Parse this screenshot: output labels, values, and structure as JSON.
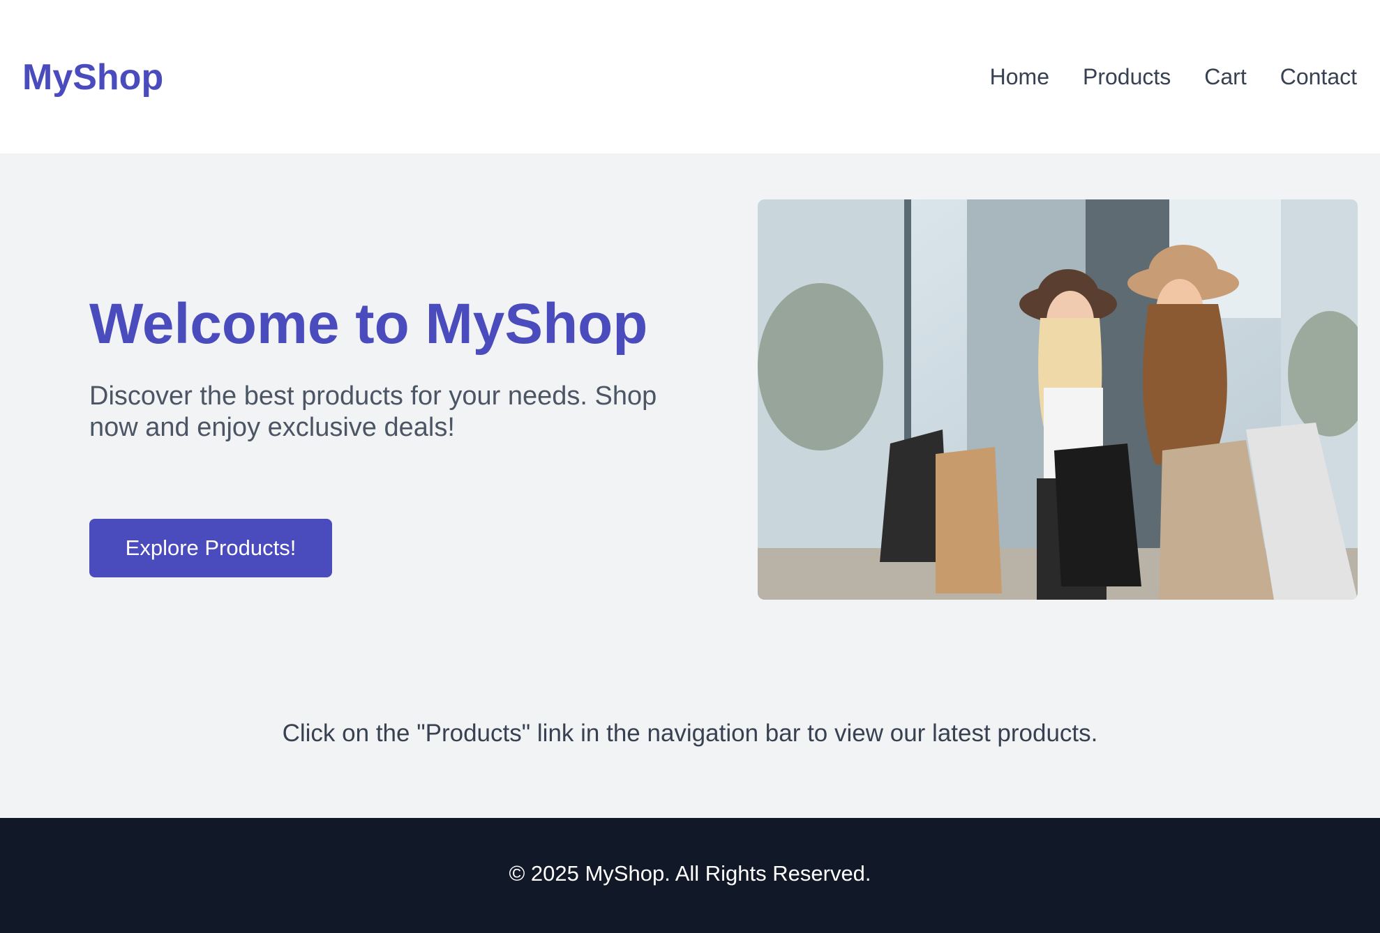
{
  "header": {
    "logo": "MyShop",
    "nav": [
      "Home",
      "Products",
      "Cart",
      "Contact"
    ]
  },
  "hero": {
    "title": "Welcome to MyShop",
    "subtitle": "Discover the best products for your needs. Shop now and enjoy exclusive deals!",
    "cta_label": "Explore Products!"
  },
  "hint": "Click on the \"Products\" link in the navigation bar to view our latest products.",
  "footer": {
    "copyright": "© 2025 MyShop. All Rights Reserved."
  },
  "colors": {
    "brand": "#4a4bbd",
    "background": "#f2f3f5",
    "footer": "#111827",
    "text": "#374151"
  }
}
